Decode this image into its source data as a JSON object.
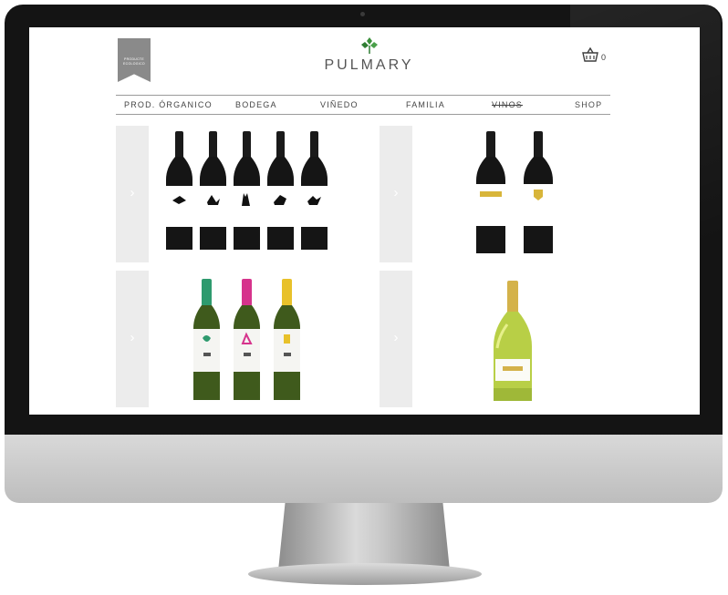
{
  "screen": {
    "badge": {
      "lines": [
        "PRODUCTE",
        "ECOLOGICO"
      ]
    },
    "logo": {
      "text": "PULMARY",
      "mark_icon": "grape-leaf-icon",
      "mark_color": "#3a8f3a"
    },
    "cart": {
      "icon": "basket-icon",
      "count": "0"
    },
    "nav": {
      "items": [
        {
          "label": "PROD. ÓRGANICO"
        },
        {
          "label": "BODEGA"
        },
        {
          "label": "VIÑEDO"
        },
        {
          "label": "FAMILIA"
        },
        {
          "label": "VINOS",
          "active": true
        },
        {
          "label": "SHOP"
        }
      ]
    },
    "products": [
      {
        "arrow": "›",
        "bottles": 5,
        "type": "red-wine",
        "label_color": "#ffffff"
      },
      {
        "arrow": "›",
        "bottles": 2,
        "type": "red-wine",
        "label_color": "#ffffff"
      },
      {
        "arrow": "›",
        "bottles": 3,
        "type": "white-wine",
        "capsule_colors": [
          "#2e9a6e",
          "#d6338c",
          "#e8c12a"
        ]
      },
      {
        "arrow": "›",
        "bottles": 1,
        "type": "sparkling-wine",
        "capsule_colors": [
          "#d4b24a"
        ]
      }
    ]
  },
  "colors": {
    "bezel": "#141414",
    "chin": "#cfcfcf",
    "panel": "#ececec",
    "nav_text": "#444444"
  }
}
